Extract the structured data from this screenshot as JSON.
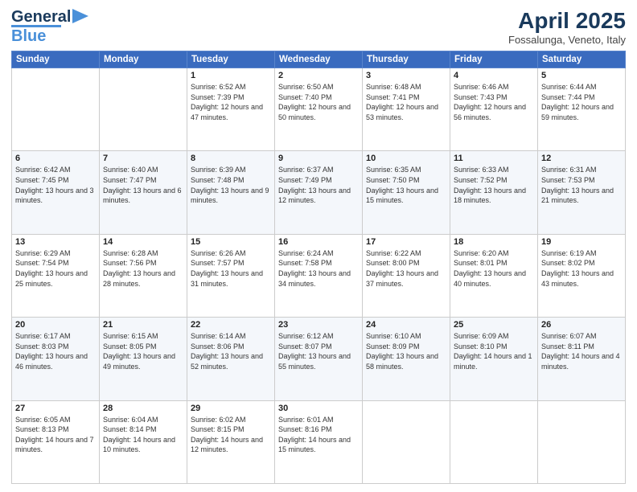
{
  "logo": {
    "line1": "General",
    "line2": "Blue"
  },
  "title": "April 2025",
  "subtitle": "Fossalunga, Veneto, Italy",
  "headers": [
    "Sunday",
    "Monday",
    "Tuesday",
    "Wednesday",
    "Thursday",
    "Friday",
    "Saturday"
  ],
  "weeks": [
    [
      {
        "day": "",
        "info": ""
      },
      {
        "day": "",
        "info": ""
      },
      {
        "day": "1",
        "info": "Sunrise: 6:52 AM\nSunset: 7:39 PM\nDaylight: 12 hours and 47 minutes."
      },
      {
        "day": "2",
        "info": "Sunrise: 6:50 AM\nSunset: 7:40 PM\nDaylight: 12 hours and 50 minutes."
      },
      {
        "day": "3",
        "info": "Sunrise: 6:48 AM\nSunset: 7:41 PM\nDaylight: 12 hours and 53 minutes."
      },
      {
        "day": "4",
        "info": "Sunrise: 6:46 AM\nSunset: 7:43 PM\nDaylight: 12 hours and 56 minutes."
      },
      {
        "day": "5",
        "info": "Sunrise: 6:44 AM\nSunset: 7:44 PM\nDaylight: 12 hours and 59 minutes."
      }
    ],
    [
      {
        "day": "6",
        "info": "Sunrise: 6:42 AM\nSunset: 7:45 PM\nDaylight: 13 hours and 3 minutes."
      },
      {
        "day": "7",
        "info": "Sunrise: 6:40 AM\nSunset: 7:47 PM\nDaylight: 13 hours and 6 minutes."
      },
      {
        "day": "8",
        "info": "Sunrise: 6:39 AM\nSunset: 7:48 PM\nDaylight: 13 hours and 9 minutes."
      },
      {
        "day": "9",
        "info": "Sunrise: 6:37 AM\nSunset: 7:49 PM\nDaylight: 13 hours and 12 minutes."
      },
      {
        "day": "10",
        "info": "Sunrise: 6:35 AM\nSunset: 7:50 PM\nDaylight: 13 hours and 15 minutes."
      },
      {
        "day": "11",
        "info": "Sunrise: 6:33 AM\nSunset: 7:52 PM\nDaylight: 13 hours and 18 minutes."
      },
      {
        "day": "12",
        "info": "Sunrise: 6:31 AM\nSunset: 7:53 PM\nDaylight: 13 hours and 21 minutes."
      }
    ],
    [
      {
        "day": "13",
        "info": "Sunrise: 6:29 AM\nSunset: 7:54 PM\nDaylight: 13 hours and 25 minutes."
      },
      {
        "day": "14",
        "info": "Sunrise: 6:28 AM\nSunset: 7:56 PM\nDaylight: 13 hours and 28 minutes."
      },
      {
        "day": "15",
        "info": "Sunrise: 6:26 AM\nSunset: 7:57 PM\nDaylight: 13 hours and 31 minutes."
      },
      {
        "day": "16",
        "info": "Sunrise: 6:24 AM\nSunset: 7:58 PM\nDaylight: 13 hours and 34 minutes."
      },
      {
        "day": "17",
        "info": "Sunrise: 6:22 AM\nSunset: 8:00 PM\nDaylight: 13 hours and 37 minutes."
      },
      {
        "day": "18",
        "info": "Sunrise: 6:20 AM\nSunset: 8:01 PM\nDaylight: 13 hours and 40 minutes."
      },
      {
        "day": "19",
        "info": "Sunrise: 6:19 AM\nSunset: 8:02 PM\nDaylight: 13 hours and 43 minutes."
      }
    ],
    [
      {
        "day": "20",
        "info": "Sunrise: 6:17 AM\nSunset: 8:03 PM\nDaylight: 13 hours and 46 minutes."
      },
      {
        "day": "21",
        "info": "Sunrise: 6:15 AM\nSunset: 8:05 PM\nDaylight: 13 hours and 49 minutes."
      },
      {
        "day": "22",
        "info": "Sunrise: 6:14 AM\nSunset: 8:06 PM\nDaylight: 13 hours and 52 minutes."
      },
      {
        "day": "23",
        "info": "Sunrise: 6:12 AM\nSunset: 8:07 PM\nDaylight: 13 hours and 55 minutes."
      },
      {
        "day": "24",
        "info": "Sunrise: 6:10 AM\nSunset: 8:09 PM\nDaylight: 13 hours and 58 minutes."
      },
      {
        "day": "25",
        "info": "Sunrise: 6:09 AM\nSunset: 8:10 PM\nDaylight: 14 hours and 1 minute."
      },
      {
        "day": "26",
        "info": "Sunrise: 6:07 AM\nSunset: 8:11 PM\nDaylight: 14 hours and 4 minutes."
      }
    ],
    [
      {
        "day": "27",
        "info": "Sunrise: 6:05 AM\nSunset: 8:13 PM\nDaylight: 14 hours and 7 minutes."
      },
      {
        "day": "28",
        "info": "Sunrise: 6:04 AM\nSunset: 8:14 PM\nDaylight: 14 hours and 10 minutes."
      },
      {
        "day": "29",
        "info": "Sunrise: 6:02 AM\nSunset: 8:15 PM\nDaylight: 14 hours and 12 minutes."
      },
      {
        "day": "30",
        "info": "Sunrise: 6:01 AM\nSunset: 8:16 PM\nDaylight: 14 hours and 15 minutes."
      },
      {
        "day": "",
        "info": ""
      },
      {
        "day": "",
        "info": ""
      },
      {
        "day": "",
        "info": ""
      }
    ]
  ]
}
